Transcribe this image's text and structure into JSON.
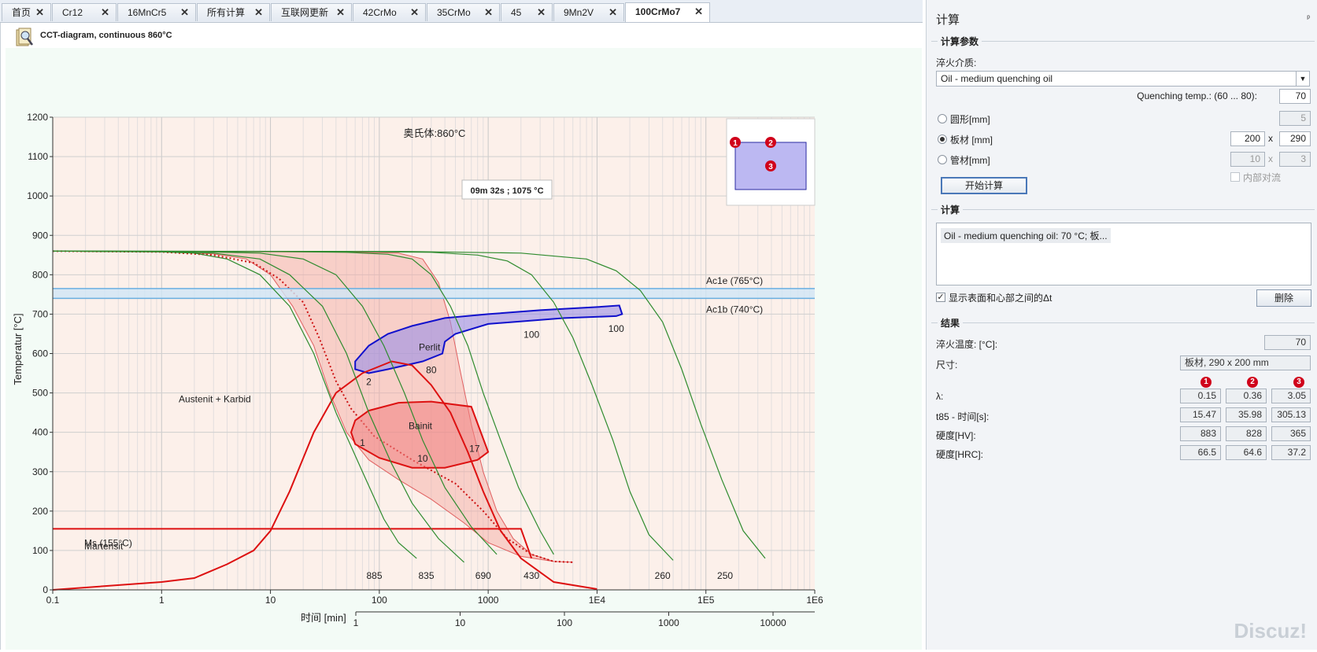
{
  "tabs": [
    {
      "label": "首页"
    },
    {
      "label": "Cr12"
    },
    {
      "label": "16MnCr5"
    },
    {
      "label": "所有计算"
    },
    {
      "label": "互联网更新"
    },
    {
      "label": "42CrMo"
    },
    {
      "label": "35CrMo"
    },
    {
      "label": "45"
    },
    {
      "label": "9Mn2V"
    },
    {
      "label": "100CrMo7"
    }
  ],
  "close_glyph": "✕",
  "document": {
    "title": "CCT-diagram, continuous 860°C",
    "icon": "magnifier-document-icon"
  },
  "chart_data": {
    "type": "line",
    "title": "奥氏体:860°C",
    "xlabel": "时间 [min]",
    "ylabel": "Temperatur [°C]",
    "x_scale": "log",
    "xlim": [
      0.1,
      1000000
    ],
    "ylim": [
      0,
      1200
    ],
    "y_ticks": [
      "0",
      "100",
      "200",
      "300",
      "400",
      "500",
      "600",
      "700",
      "800",
      "900",
      "1000",
      "1100",
      "1200"
    ],
    "x_ticks": [
      "0.1",
      "1",
      "10",
      "100",
      "1000",
      "1E4",
      "1E5",
      "1E6"
    ],
    "x2_ticks": [
      "1",
      "10",
      "100",
      "1000",
      "10000"
    ],
    "grid": true,
    "cursor_readout": "09m 32s ; 1075 °C",
    "lines": {
      "ac1e": {
        "label": "Ac1e (765°C)",
        "y": 765
      },
      "ac1b": {
        "label": "Ac1b (740°C)",
        "y": 740
      },
      "ms": {
        "label": "Ms (155°C)",
        "y": 155
      }
    },
    "regions": {
      "austenit_karbid": "Austenit + Karbid",
      "martensit": "Martensit",
      "perlit": "Perlit",
      "bainit": "Bainit"
    },
    "cooling_hardness_labels": [
      "885",
      "835",
      "690",
      "430",
      "260",
      "250"
    ],
    "percent_labels": [
      {
        "text": "1",
        "x": 70,
        "y": 365
      },
      {
        "text": "2",
        "x": 80,
        "y": 520
      },
      {
        "text": "10",
        "x": 250,
        "y": 325
      },
      {
        "text": "17",
        "x": 750,
        "y": 350
      },
      {
        "text": "80",
        "x": 300,
        "y": 550
      },
      {
        "text": "100",
        "x": 2500,
        "y": 640
      },
      {
        "text": "100",
        "x": 15000,
        "y": 655
      }
    ],
    "series": [
      {
        "type": "cooling_curve",
        "points": [
          [
            0.1,
            860
          ],
          [
            1,
            858
          ],
          [
            2,
            855
          ],
          [
            4,
            840
          ],
          [
            8,
            800
          ],
          [
            15,
            720
          ],
          [
            25,
            600
          ],
          [
            40,
            450
          ],
          [
            70,
            300
          ],
          [
            110,
            180
          ],
          [
            150,
            120
          ],
          [
            220,
            80
          ]
        ]
      },
      {
        "type": "cooling_curve",
        "points": [
          [
            0.1,
            860
          ],
          [
            1,
            859
          ],
          [
            3,
            855
          ],
          [
            8,
            840
          ],
          [
            15,
            800
          ],
          [
            30,
            720
          ],
          [
            50,
            600
          ],
          [
            80,
            450
          ],
          [
            130,
            320
          ],
          [
            200,
            220
          ],
          [
            350,
            130
          ],
          [
            600,
            70
          ]
        ]
      },
      {
        "type": "cooling_curve",
        "points": [
          [
            0.1,
            860
          ],
          [
            2,
            859
          ],
          [
            8,
            855
          ],
          [
            20,
            840
          ],
          [
            40,
            800
          ],
          [
            70,
            720
          ],
          [
            110,
            620
          ],
          [
            170,
            500
          ],
          [
            250,
            380
          ],
          [
            400,
            260
          ],
          [
            700,
            160
          ],
          [
            1200,
            90
          ]
        ]
      },
      {
        "type": "cooling_curve",
        "points": [
          [
            0.1,
            860
          ],
          [
            10,
            859
          ],
          [
            50,
            857
          ],
          [
            120,
            852
          ],
          [
            200,
            840
          ],
          [
            300,
            800
          ],
          [
            450,
            720
          ],
          [
            650,
            620
          ],
          [
            900,
            500
          ],
          [
            1300,
            380
          ],
          [
            1900,
            260
          ],
          [
            3000,
            150
          ],
          [
            4000,
            90
          ]
        ]
      },
      {
        "type": "cooling_curve",
        "points": [
          [
            0.1,
            860
          ],
          [
            50,
            859
          ],
          [
            300,
            857
          ],
          [
            800,
            850
          ],
          [
            1500,
            835
          ],
          [
            2500,
            800
          ],
          [
            4000,
            730
          ],
          [
            6000,
            640
          ],
          [
            9000,
            520
          ],
          [
            14000,
            380
          ],
          [
            20000,
            250
          ],
          [
            30000,
            140
          ],
          [
            50000,
            75
          ]
        ]
      },
      {
        "type": "cooling_curve",
        "points": [
          [
            0.1,
            860
          ],
          [
            200,
            859
          ],
          [
            2000,
            855
          ],
          [
            8000,
            840
          ],
          [
            15000,
            810
          ],
          [
            25000,
            760
          ],
          [
            40000,
            680
          ],
          [
            60000,
            560
          ],
          [
            90000,
            420
          ],
          [
            140000,
            280
          ],
          [
            220000,
            150
          ],
          [
            350000,
            80
          ]
        ]
      }
    ],
    "phase_boundaries": {
      "ms_line": [
        [
          0.1,
          155
        ],
        [
          2000,
          155
        ]
      ],
      "martensite_boundary": [
        [
          0.1,
          0
        ],
        [
          1,
          20
        ],
        [
          2,
          30
        ],
        [
          4,
          65
        ],
        [
          7,
          100
        ],
        [
          10,
          150
        ],
        [
          15,
          250
        ],
        [
          25,
          400
        ],
        [
          40,
          500
        ],
        [
          70,
          550
        ],
        [
          130,
          580
        ],
        [
          200,
          570
        ],
        [
          300,
          520
        ],
        [
          450,
          450
        ],
        [
          650,
          350
        ],
        [
          900,
          250
        ],
        [
          1300,
          150
        ],
        [
          2000,
          80
        ],
        [
          4000,
          20
        ],
        [
          10000,
          2
        ]
      ],
      "perlit_region": [
        [
          60,
          580
        ],
        [
          80,
          620
        ],
        [
          120,
          650
        ],
        [
          200,
          670
        ],
        [
          400,
          690
        ],
        [
          1000,
          700
        ],
        [
          3000,
          710
        ],
        [
          10000,
          718
        ],
        [
          16000,
          722
        ],
        [
          17000,
          700
        ],
        [
          15000,
          695
        ],
        [
          5000,
          690
        ],
        [
          1000,
          675
        ],
        [
          500,
          650
        ],
        [
          400,
          630
        ],
        [
          380,
          600
        ],
        [
          250,
          580
        ],
        [
          120,
          560
        ],
        [
          80,
          550
        ],
        [
          60,
          560
        ]
      ],
      "bainit_region": [
        [
          60,
          430
        ],
        [
          80,
          455
        ],
        [
          150,
          475
        ],
        [
          300,
          478
        ],
        [
          700,
          465
        ],
        [
          1000,
          350
        ],
        [
          800,
          330
        ],
        [
          400,
          310
        ],
        [
          200,
          310
        ],
        [
          100,
          335
        ],
        [
          60,
          370
        ],
        [
          55,
          400
        ]
      ]
    },
    "shaded_band": {
      "upper": [
        [
          0.1,
          860
        ],
        [
          2,
          859
        ],
        [
          30,
          858
        ],
        [
          150,
          855
        ],
        [
          250,
          840
        ],
        [
          350,
          780
        ],
        [
          450,
          680
        ],
        [
          550,
          560
        ],
        [
          700,
          420
        ],
        [
          900,
          300
        ],
        [
          1200,
          200
        ],
        [
          1700,
          130
        ],
        [
          2500,
          90
        ],
        [
          4000,
          72
        ],
        [
          6000,
          70
        ]
      ],
      "lower": [
        [
          0.1,
          860
        ],
        [
          1,
          858
        ],
        [
          3,
          853
        ],
        [
          6,
          840
        ],
        [
          10,
          800
        ],
        [
          16,
          720
        ],
        [
          25,
          620
        ],
        [
          35,
          500
        ],
        [
          50,
          400
        ],
        [
          80,
          330
        ],
        [
          150,
          280
        ],
        [
          300,
          230
        ],
        [
          600,
          170
        ],
        [
          1000,
          120
        ],
        [
          2000,
          85
        ],
        [
          4000,
          72
        ],
        [
          6000,
          70
        ]
      ],
      "median": [
        [
          0.1,
          860
        ],
        [
          1,
          858
        ],
        [
          3,
          850
        ],
        [
          7,
          830
        ],
        [
          12,
          790
        ],
        [
          20,
          730
        ],
        [
          28,
          640
        ],
        [
          40,
          530
        ],
        [
          55,
          460
        ],
        [
          90,
          390
        ],
        [
          200,
          330
        ],
        [
          500,
          270
        ],
        [
          900,
          200
        ],
        [
          1500,
          130
        ],
        [
          2500,
          90
        ],
        [
          4000,
          72
        ],
        [
          6000,
          70
        ]
      ]
    },
    "inset_points": [
      "1",
      "2",
      "3"
    ]
  },
  "panel": {
    "title": "计算",
    "pin": "ᵖ",
    "params": {
      "header": "计算参数",
      "medium_label": "淬火介质:",
      "medium_value": "Oil - medium quenching oil",
      "quench_temp_label": "Quenching temp.: (60 ... 80):",
      "quench_temp_value": "70",
      "round_label": "圆形[mm]",
      "round_value": "5",
      "plate_label": "板材 [mm]",
      "plate_w": "200",
      "plate_h": "290",
      "tube_label": "管材[mm]",
      "tube_a": "10",
      "tube_b": "3",
      "inner_flow_label": "内部对流",
      "times": "x",
      "start_button": "开始计算"
    },
    "calc": {
      "header": "计算",
      "item": "Oil - medium quenching oil: 70 °C; 板...",
      "show_delta_label": "显示表面和心部之间的Δt",
      "delete_button": "删除"
    },
    "results": {
      "header": "结果",
      "quench_temp_label": "淬火温度: [°C]:",
      "quench_temp_value": "70",
      "size_label": "尺寸:",
      "size_value": "板材, 290 x 200 mm",
      "col_labels": [
        "1",
        "2",
        "3"
      ],
      "rows": [
        {
          "label": "λ:",
          "v": [
            "0.15",
            "0.36",
            "3.05"
          ]
        },
        {
          "label": "t85 - 时间[s]:",
          "v": [
            "15.47",
            "35.98",
            "305.13"
          ]
        },
        {
          "label": "硬度[HV]:",
          "v": [
            "883",
            "828",
            "365"
          ]
        },
        {
          "label": "硬度[HRC]:",
          "v": [
            "66.5",
            "64.6",
            "37.2"
          ]
        }
      ]
    }
  },
  "watermark": "Discuz!"
}
